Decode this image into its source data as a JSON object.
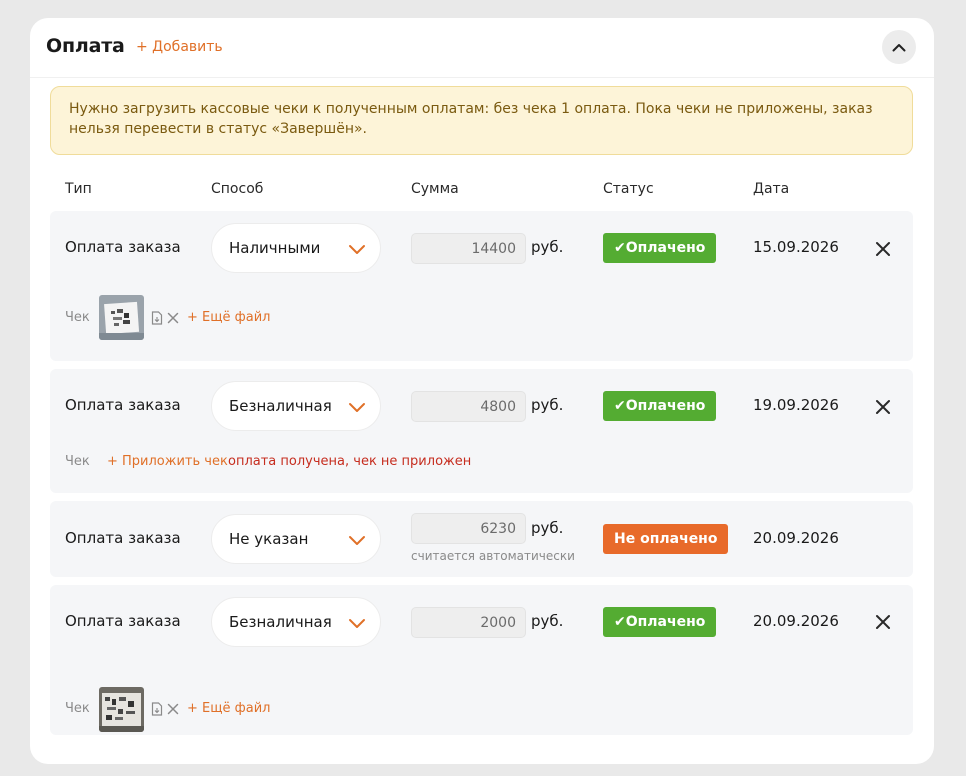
{
  "section": {
    "title": "Оплата",
    "add_label": "+ Добавить",
    "collapse_icon": "chevron-up-icon"
  },
  "alert": {
    "text": "Нужно загрузить кассовые чеки к полученным оплатам: без чека 1 оплата. Пока чеки не приложены, заказ нельзя перевести в статус «Завершён»."
  },
  "columns": {
    "type": "Тип",
    "method": "Способ",
    "amount": "Сумма",
    "status": "Статус",
    "date": "Дата"
  },
  "currency": "руб.",
  "receipt_label": "Чек",
  "more_file_label": "+ Ещё файл",
  "attach_label": "+ Приложить чек",
  "payments": [
    {
      "type": "Оплата заказа",
      "method": "Наличными",
      "amount": "14400",
      "status": "✔Оплачено",
      "date": "15.09.2026"
    },
    {
      "type": "Оплата заказа",
      "method": "Безналичная",
      "amount": "4800",
      "status": "✔Оплачено",
      "date": "19.09.2026",
      "warning": "оплата получена, чек не приложен"
    },
    {
      "type": "Оплата заказа",
      "method": "Не указан",
      "amount": "6230",
      "amount_note": "считается автоматически",
      "status": "Не оплачено",
      "date": "20.09.2026"
    },
    {
      "type": "Оплата заказа",
      "method": "Безналичная",
      "amount": "2000",
      "status": "✔Оплачено",
      "date": "20.09.2026"
    }
  ],
  "colors": {
    "accent": "#e07028",
    "paid": "#54ac32",
    "unpaid": "#e86a2a",
    "warning_text": "#c62d1f",
    "alert_bg": "#fdf4d8"
  }
}
